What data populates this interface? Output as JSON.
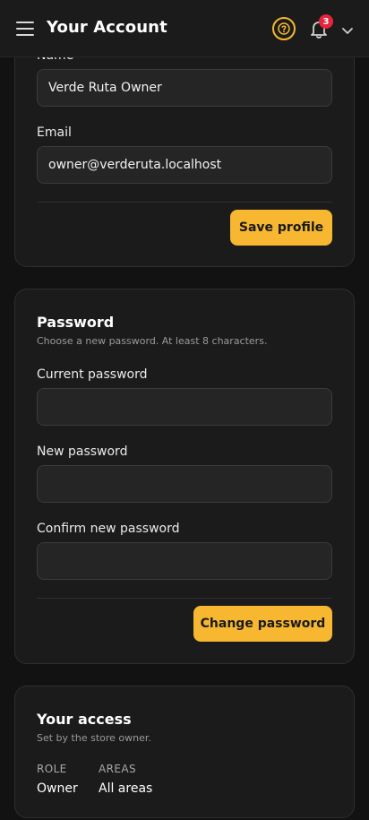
{
  "header": {
    "title": "Your Account",
    "notification_count": "3"
  },
  "profile": {
    "name_label": "Name",
    "name_value": "Verde Ruta Owner",
    "email_label": "Email",
    "email_value": "owner@verderuta.localhost",
    "save_label": "Save profile"
  },
  "password": {
    "title": "Password",
    "subtitle": "Choose a new password. At least 8 characters.",
    "current_label": "Current password",
    "new_label": "New password",
    "confirm_label": "Confirm new password",
    "change_label": "Change password"
  },
  "access": {
    "title": "Your access",
    "subtitle": "Set by the store owner.",
    "role_key": "ROLE",
    "role_value": "Owner",
    "areas_key": "AREAS",
    "areas_value": "All areas"
  },
  "colors": {
    "accent": "#f7b731",
    "badge": "#e5253c",
    "background": "#121212",
    "card": "#1b1b1b"
  }
}
